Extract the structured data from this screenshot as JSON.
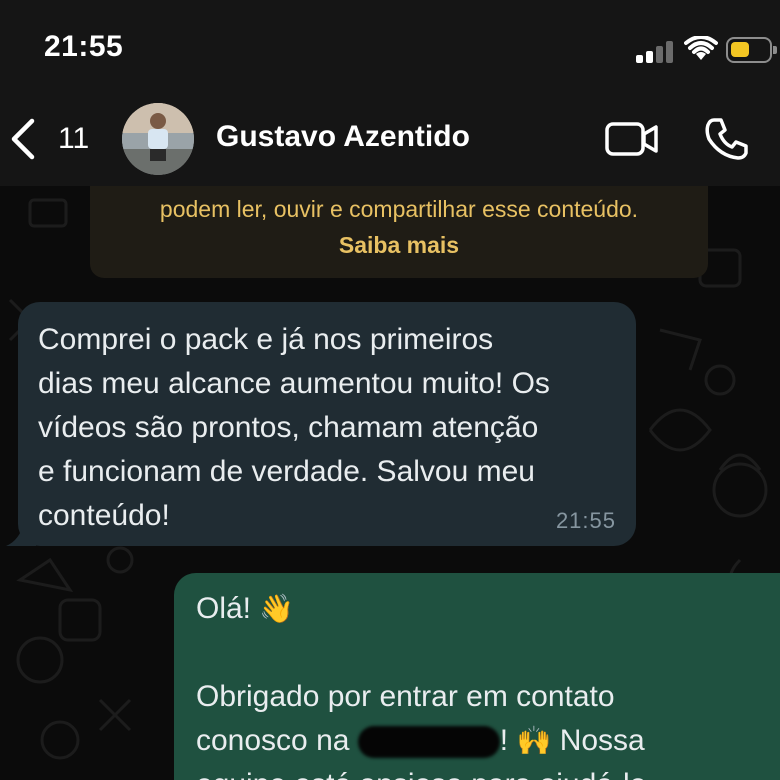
{
  "status_bar": {
    "time": "21:55"
  },
  "header": {
    "back_count": "11",
    "contact_name": "Gustavo Azentido"
  },
  "encryption_notice": {
    "text": "podem ler, ouvir e compartilhar esse conteúdo.",
    "link": "Saiba mais"
  },
  "messages": {
    "incoming": {
      "text": "Comprei o pack e já nos primeiros\ndias meu alcance aumentou muito! Os\nvídeos são prontos, chamam atenção\ne funcionam de verdade. Salvou meu\nconteúdo!",
      "time": "21:55"
    },
    "outgoing": {
      "greeting": "Olá!",
      "greeting_emoji": "👋",
      "line1": "Obrigado por entrar em contato",
      "line2_start": "conosco na",
      "line2_after": "!",
      "line2_emoji": "🙌",
      "line2_end": "Nossa",
      "line3": "equipe está ansiosa para ajudá-lo"
    }
  },
  "colors": {
    "accent_notice": "#e8c163",
    "incoming_bubble": "#202c33",
    "outgoing_bubble": "#1f5140",
    "battery": "#f3c623"
  }
}
